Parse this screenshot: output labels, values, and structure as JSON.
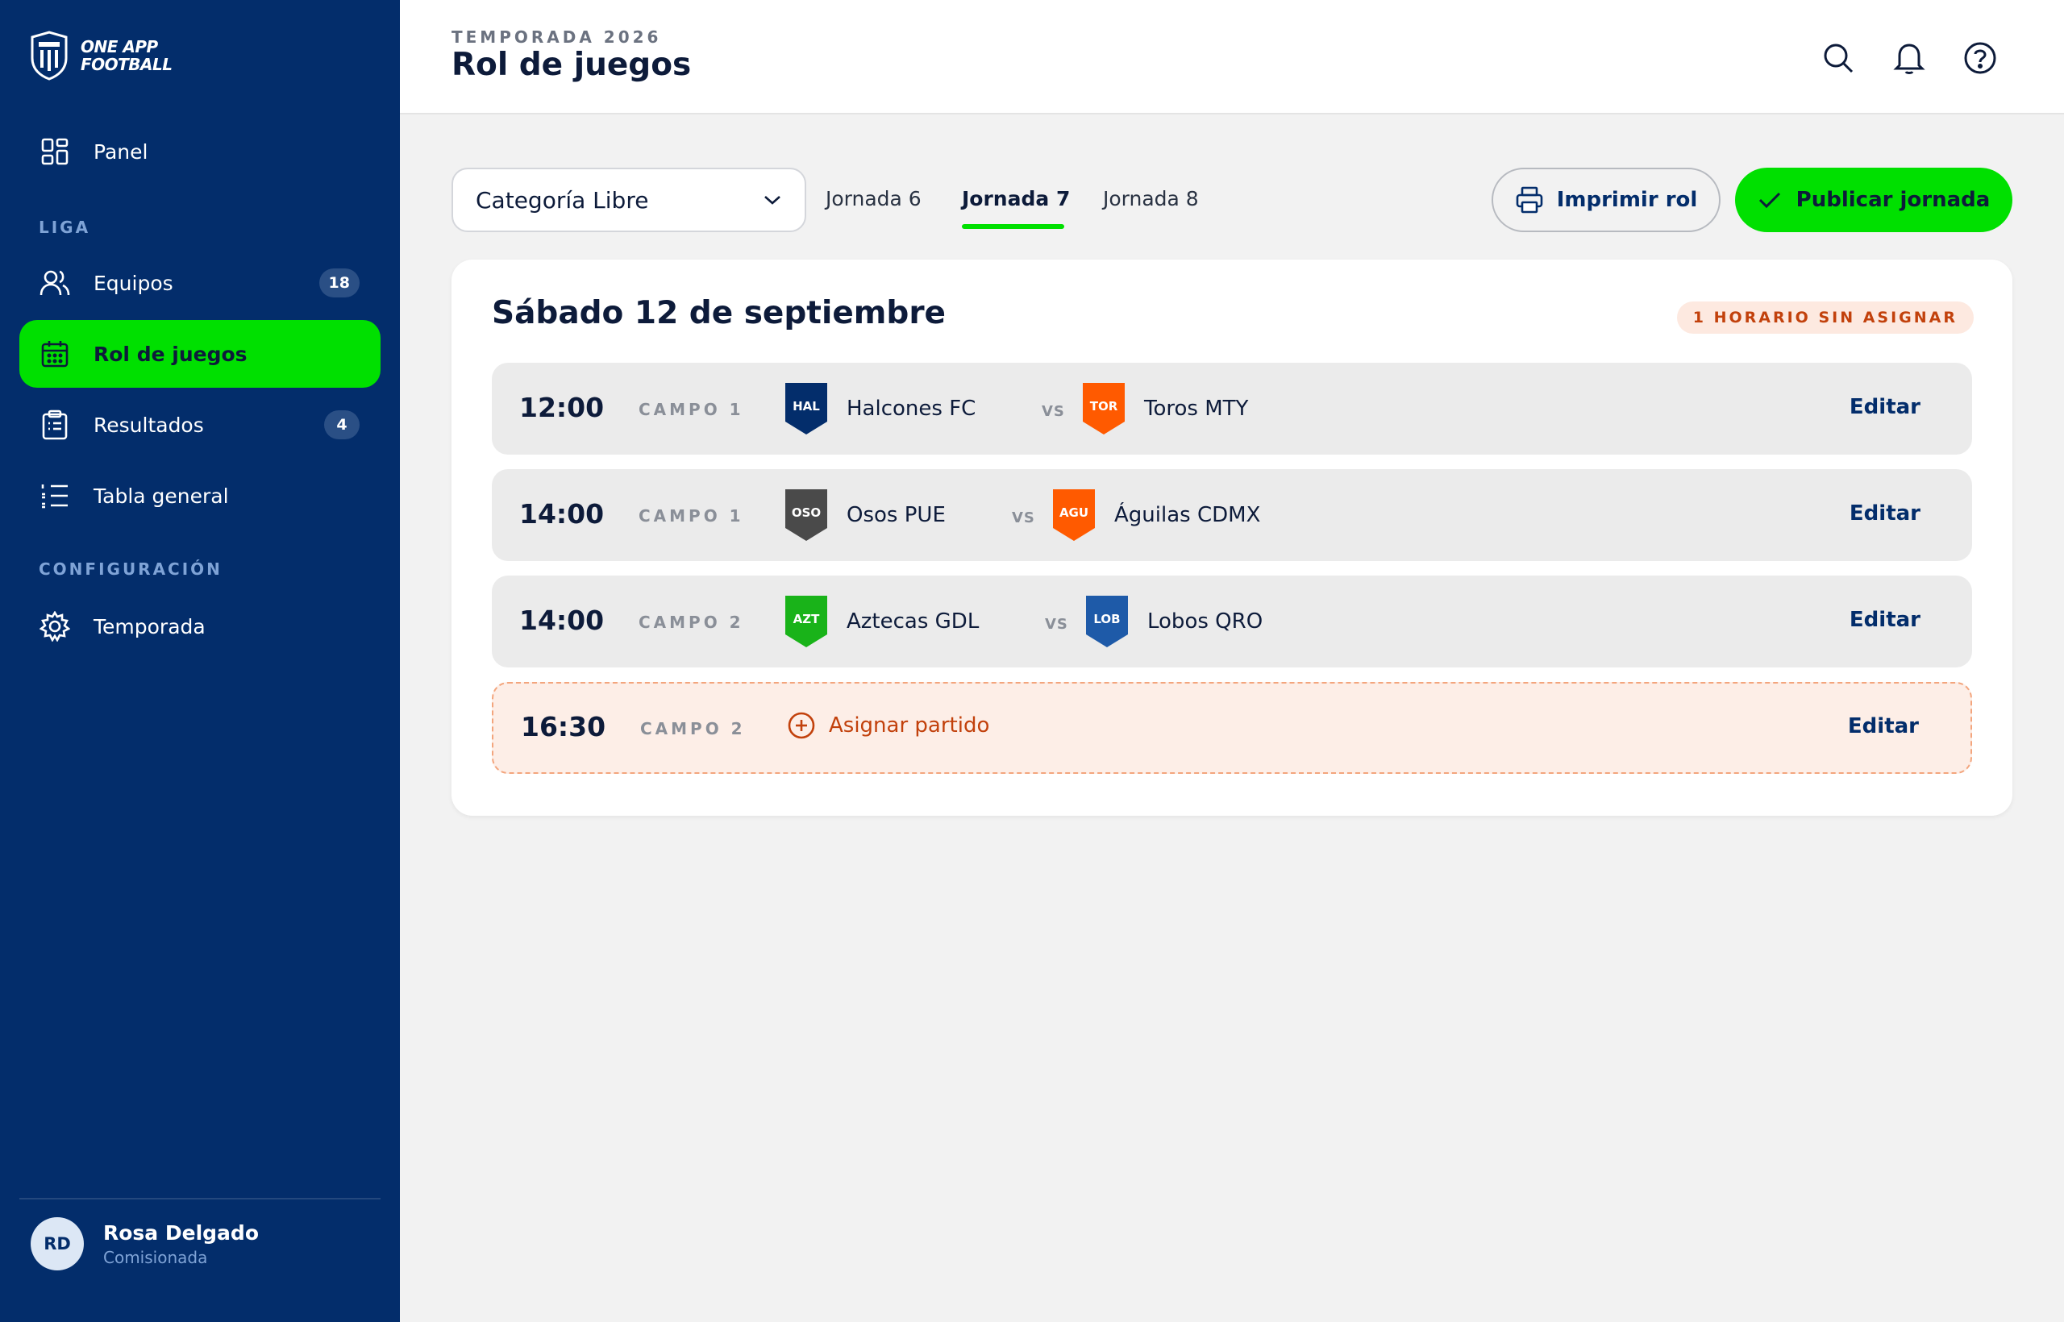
{
  "app": {
    "logo_line1": "ONE APP",
    "logo_line2": "FOOTBALL"
  },
  "sidebar": {
    "panel": "Panel",
    "section_liga": "LIGA",
    "items": [
      {
        "label": "Equipos",
        "badge": "18"
      },
      {
        "label": "Rol de juegos",
        "badge": ""
      },
      {
        "label": "Resultados",
        "badge": "4"
      },
      {
        "label": "Tabla general",
        "badge": ""
      }
    ],
    "section_config": "CONFIGURACIÓN",
    "temporada": "Temporada",
    "user": {
      "initials": "RD",
      "name": "Rosa Delgado",
      "role": "Comisionada"
    }
  },
  "header": {
    "eyebrow": "TEMPORADA 2026",
    "title": "Rol de juegos"
  },
  "toolbar": {
    "category": "Categoría Libre",
    "tabs": [
      "Jornada 6",
      "Jornada 7",
      "Jornada 8"
    ],
    "print": "Imprimir rol",
    "publish": "Publicar jornada"
  },
  "schedule": {
    "date": "Sábado 12 de septiembre",
    "warning": "1 HORARIO SIN ASIGNAR",
    "vs": "VS",
    "edit": "Editar",
    "assign": "Asignar partido",
    "matches": [
      {
        "time": "12:00",
        "field": "CAMPO 1",
        "home": "Halcones FC",
        "home_abbr": "HAL",
        "away": "Toros MTY",
        "away_abbr": "TOR"
      },
      {
        "time": "14:00",
        "field": "CAMPO 1",
        "home": "Osos PUE",
        "home_abbr": "OSO",
        "away": "Águilas CDMX",
        "away_abbr": "AGU"
      },
      {
        "time": "14:00",
        "field": "CAMPO 2",
        "home": "Aztecas GDL",
        "home_abbr": "AZT",
        "away": "Lobos QRO",
        "away_abbr": "LOB"
      },
      {
        "time": "16:30",
        "field": "CAMPO 2"
      }
    ]
  },
  "colors": {
    "sidebar": "#032d6b",
    "accent": "#00e000",
    "warning": "#c2410c",
    "crest_hal": "#032d6b",
    "crest_tor": "#ff5a00",
    "crest_oso": "#4a4a4a",
    "crest_agu": "#ff5a00",
    "crest_azt": "#19b319",
    "crest_lob": "#1e5aa8"
  }
}
